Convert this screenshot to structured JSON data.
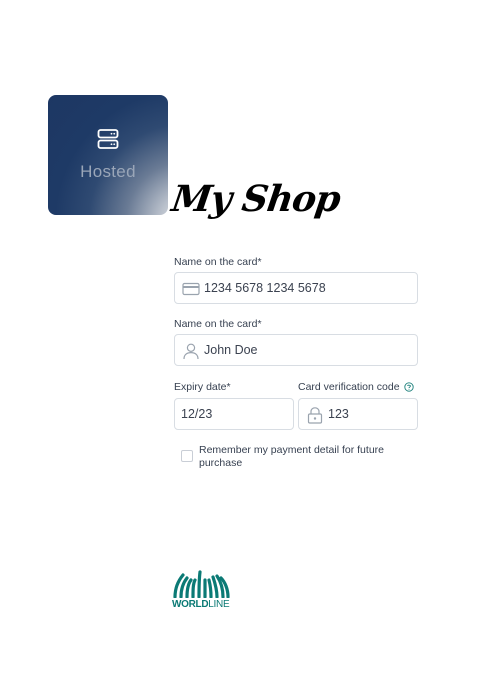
{
  "tile": {
    "label": "Hosted",
    "icon": "server-icon"
  },
  "shop": {
    "title": "My Shop"
  },
  "form": {
    "card_number": {
      "label": "Name on the card*",
      "value": "1234 5678 1234 5678",
      "icon": "credit-card-icon"
    },
    "card_name": {
      "label": "Name on the card*",
      "value": "John Doe",
      "icon": "user-icon"
    },
    "expiry": {
      "label": "Expiry date*",
      "value": "12/23"
    },
    "cvc": {
      "label": "Card verification code",
      "value": "123",
      "icon": "lock-icon",
      "help_icon": "question-circle-icon"
    },
    "remember": {
      "label": "Remember my payment detail for future purchase",
      "checked": false
    }
  },
  "footer": {
    "logo_text_primary": "WORLD",
    "logo_text_secondary": "LINE"
  },
  "colors": {
    "tile_dark": "#1d3763",
    "brand_teal": "#0b7a75",
    "help_blue": "#1a7f7a",
    "input_border": "#d8dde3"
  }
}
